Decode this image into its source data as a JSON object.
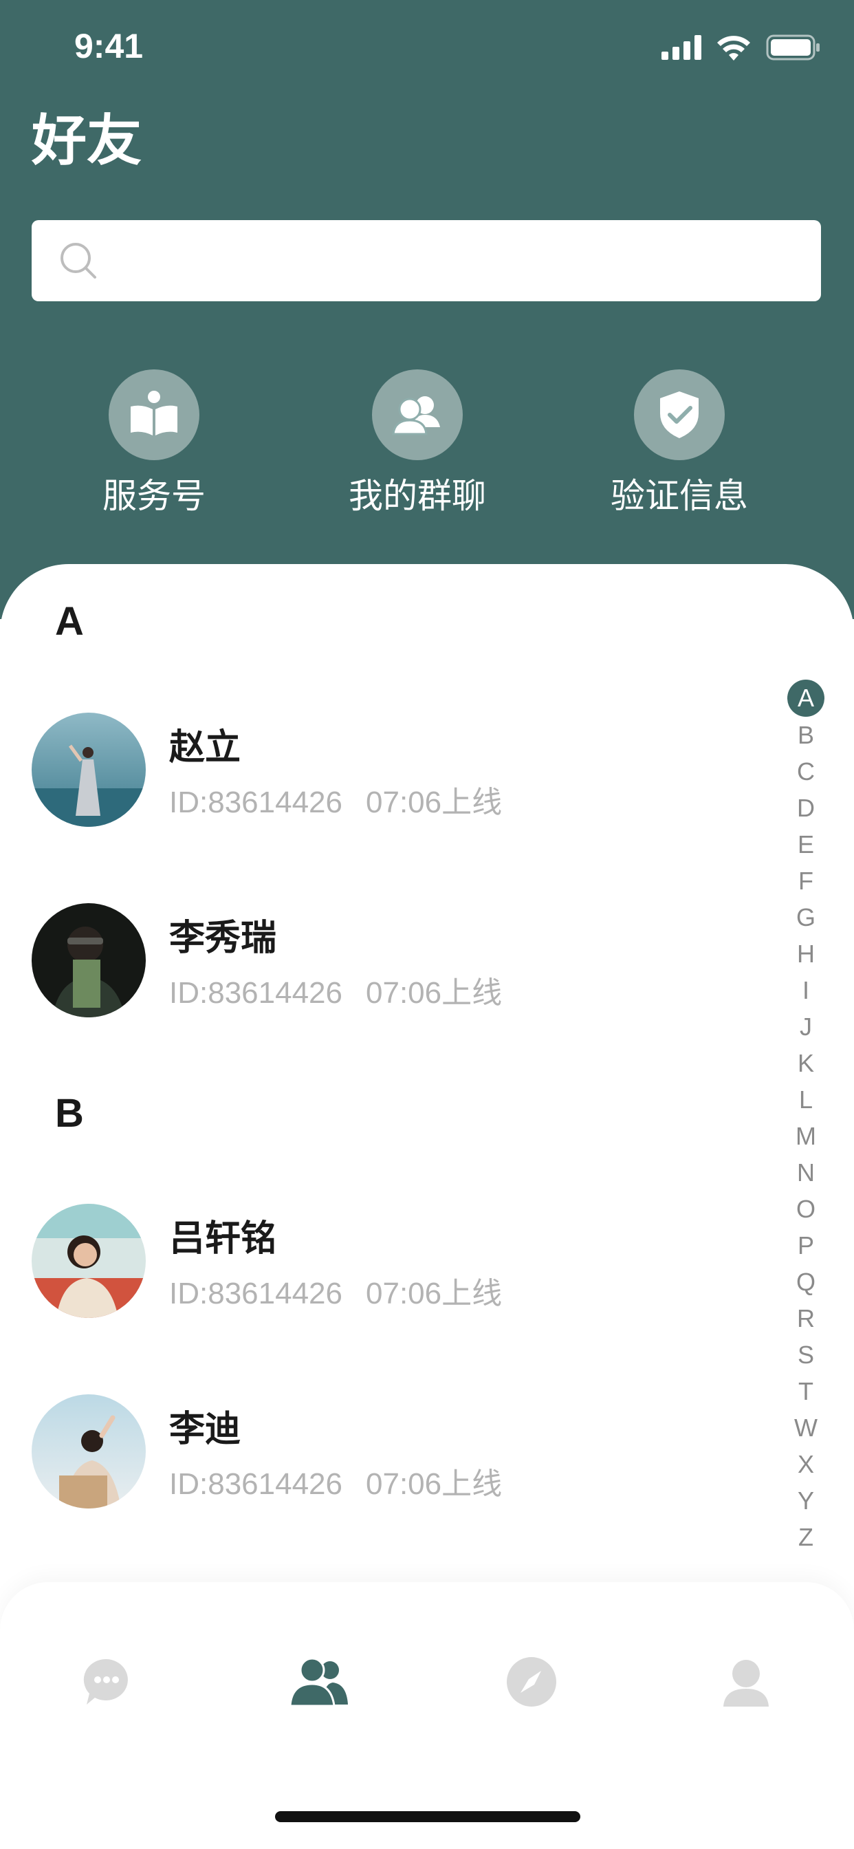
{
  "status_bar": {
    "time": "9:41"
  },
  "header": {
    "title": "好友"
  },
  "search": {
    "placeholder": ""
  },
  "shortcuts": [
    {
      "label": "服务号",
      "icon": "book-icon"
    },
    {
      "label": "我的群聊",
      "icon": "group-icon"
    },
    {
      "label": "验证信息",
      "icon": "shield-check-icon"
    }
  ],
  "sections": [
    {
      "letter": "A",
      "friends": [
        {
          "name": "赵立",
          "id": "ID:83614426",
          "online": "07:06上线"
        },
        {
          "name": "李秀瑞",
          "id": "ID:83614426",
          "online": "07:06上线"
        }
      ]
    },
    {
      "letter": "B",
      "friends": [
        {
          "name": "吕轩铭",
          "id": "ID:83614426",
          "online": "07:06上线"
        },
        {
          "name": "李迪",
          "id": "ID:83614426",
          "online": "07:06上线"
        }
      ]
    }
  ],
  "alpha_index": [
    "A",
    "B",
    "C",
    "D",
    "E",
    "F",
    "G",
    "H",
    "I",
    "J",
    "K",
    "L",
    "M",
    "N",
    "O",
    "P",
    "Q",
    "R",
    "S",
    "T",
    "W",
    "X",
    "Y",
    "Z"
  ],
  "alpha_active": "A",
  "tabbar": [
    {
      "icon": "chat-bubble-icon",
      "active": false
    },
    {
      "icon": "friends-icon",
      "active": true
    },
    {
      "icon": "compass-icon",
      "active": false
    },
    {
      "icon": "profile-icon",
      "active": false
    }
  ],
  "colors": {
    "primary": "#3f6967",
    "text_dark": "#1a1a1a",
    "text_muted": "#b3b3b3",
    "icon_inactive": "#d9d9d9"
  }
}
